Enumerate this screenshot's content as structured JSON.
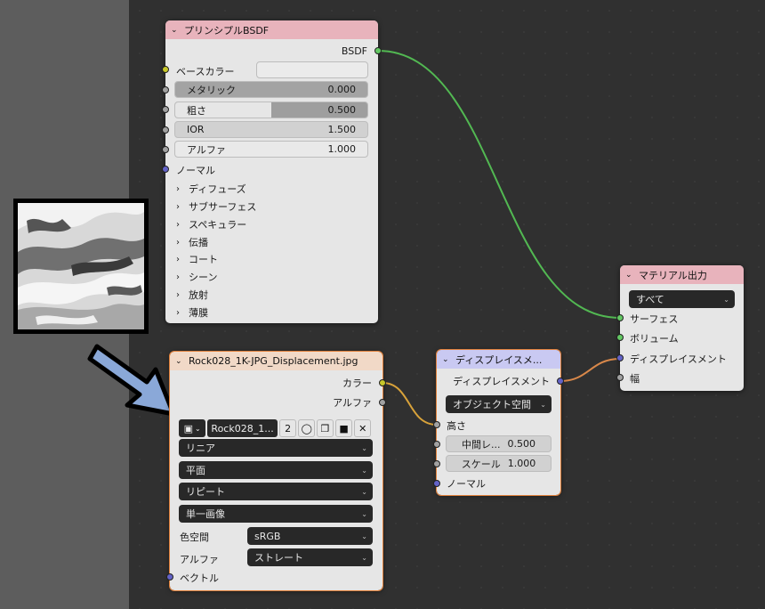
{
  "principled": {
    "title": "プリンシプルBSDF",
    "output": "BSDF",
    "base_color_label": "ベースカラー",
    "metallic": {
      "label": "メタリック",
      "value": "0.000"
    },
    "roughness": {
      "label": "粗さ",
      "value": "0.500",
      "fraction": 0.5
    },
    "ior": {
      "label": "IOR",
      "value": "1.500"
    },
    "alpha": {
      "label": "アルファ",
      "value": "1.000"
    },
    "normal_label": "ノーマル",
    "panels": [
      "ディフューズ",
      "サブサーフェス",
      "スペキュラー",
      "伝播",
      "コート",
      "シーン",
      "放射",
      "薄膜"
    ]
  },
  "image_node": {
    "title": "Rock028_1K-JPG_Displacement.jpg",
    "out_color": "カラー",
    "out_alpha": "アルファ",
    "image_name": "Rock028_1...",
    "users": "2",
    "interpolation": "リニア",
    "projection": "平面",
    "extension": "リピート",
    "source": "単一画像",
    "colorspace_label": "色空間",
    "colorspace": "sRGB",
    "alpha_label": "アルファ",
    "alpha_mode": "ストレート",
    "vector_label": "ベクトル"
  },
  "displacement": {
    "title": "ディスプレイスメ...",
    "output": "ディスプレイスメント",
    "space": "オブジェクト空間",
    "height_label": "高さ",
    "midlevel": {
      "label": "中間レ...",
      "value": "0.500"
    },
    "scale": {
      "label": "スケール",
      "value": "1.000"
    },
    "normal_label": "ノーマル"
  },
  "material_output": {
    "title": "マテリアル出力",
    "target": "すべて",
    "surface": "サーフェス",
    "volume": "ボリューム",
    "displacement": "ディスプレイスメント",
    "thickness": "幅"
  },
  "colors": {
    "editor_bg": "#303030",
    "shader_header": "#e8b3bc",
    "texture_header": "#f1d9c7",
    "vector_header": "#c9c9f2",
    "output_header": "#e8b3bc",
    "shader_link": "#52b852",
    "color_link": "#d8a23a",
    "vector_link": "#d9884a",
    "annotation_arrow": "#8aa8d8"
  }
}
